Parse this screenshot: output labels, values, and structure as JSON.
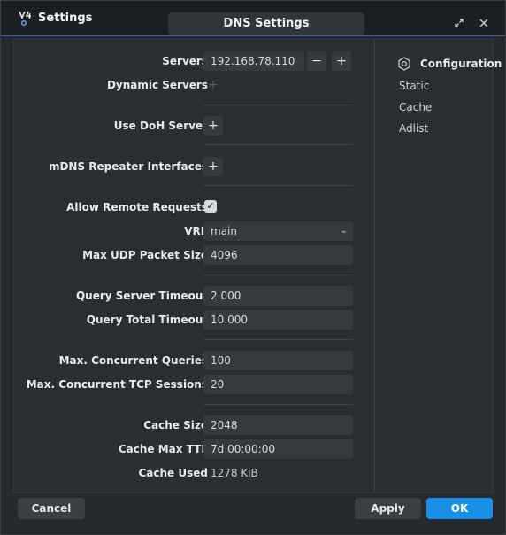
{
  "window": {
    "title": "Settings",
    "dialog_title": "DNS Settings",
    "icons": [
      "app-logo",
      "restore-icon",
      "close-icon"
    ]
  },
  "form": {
    "servers": {
      "label": "Servers",
      "value": "192.168.78.110",
      "remove": "−",
      "add": "+"
    },
    "dynamic_servers": {
      "label": "Dynamic Servers",
      "add": "+"
    },
    "use_doh": {
      "label": "Use DoH Server",
      "add": "+"
    },
    "mdns": {
      "label": "mDNS Repeater Interfaces",
      "add": "+"
    },
    "allow_remote": {
      "label": "Allow Remote Requests",
      "checked": "✓"
    },
    "vrf": {
      "label": "VRF",
      "value": "main"
    },
    "max_udp": {
      "label": "Max UDP Packet Size",
      "value": "4096"
    },
    "query_server_timeout": {
      "label": "Query Server Timeout",
      "value": "2.000"
    },
    "query_total_timeout": {
      "label": "Query Total Timeout",
      "value": "10.000"
    },
    "max_concurrent_queries": {
      "label": "Max. Concurrent Queries",
      "value": "100"
    },
    "max_concurrent_tcp": {
      "label": "Max. Concurrent TCP Sessions",
      "value": "20"
    },
    "cache_size": {
      "label": "Cache Size",
      "value": "2048"
    },
    "cache_max_ttl": {
      "label": "Cache Max TTL",
      "value": "7d 00:00:00"
    },
    "cache_used": {
      "label": "Cache Used",
      "value": "1278 KiB"
    }
  },
  "side": {
    "heading": "Configuration",
    "items": [
      "Static",
      "Cache",
      "Adlist"
    ]
  },
  "footer": {
    "cancel": "Cancel",
    "apply": "Apply",
    "ok": "OK"
  },
  "colors": {
    "accent": "#1a8fe8",
    "background": "#262a2e",
    "field": "#353a3f"
  }
}
